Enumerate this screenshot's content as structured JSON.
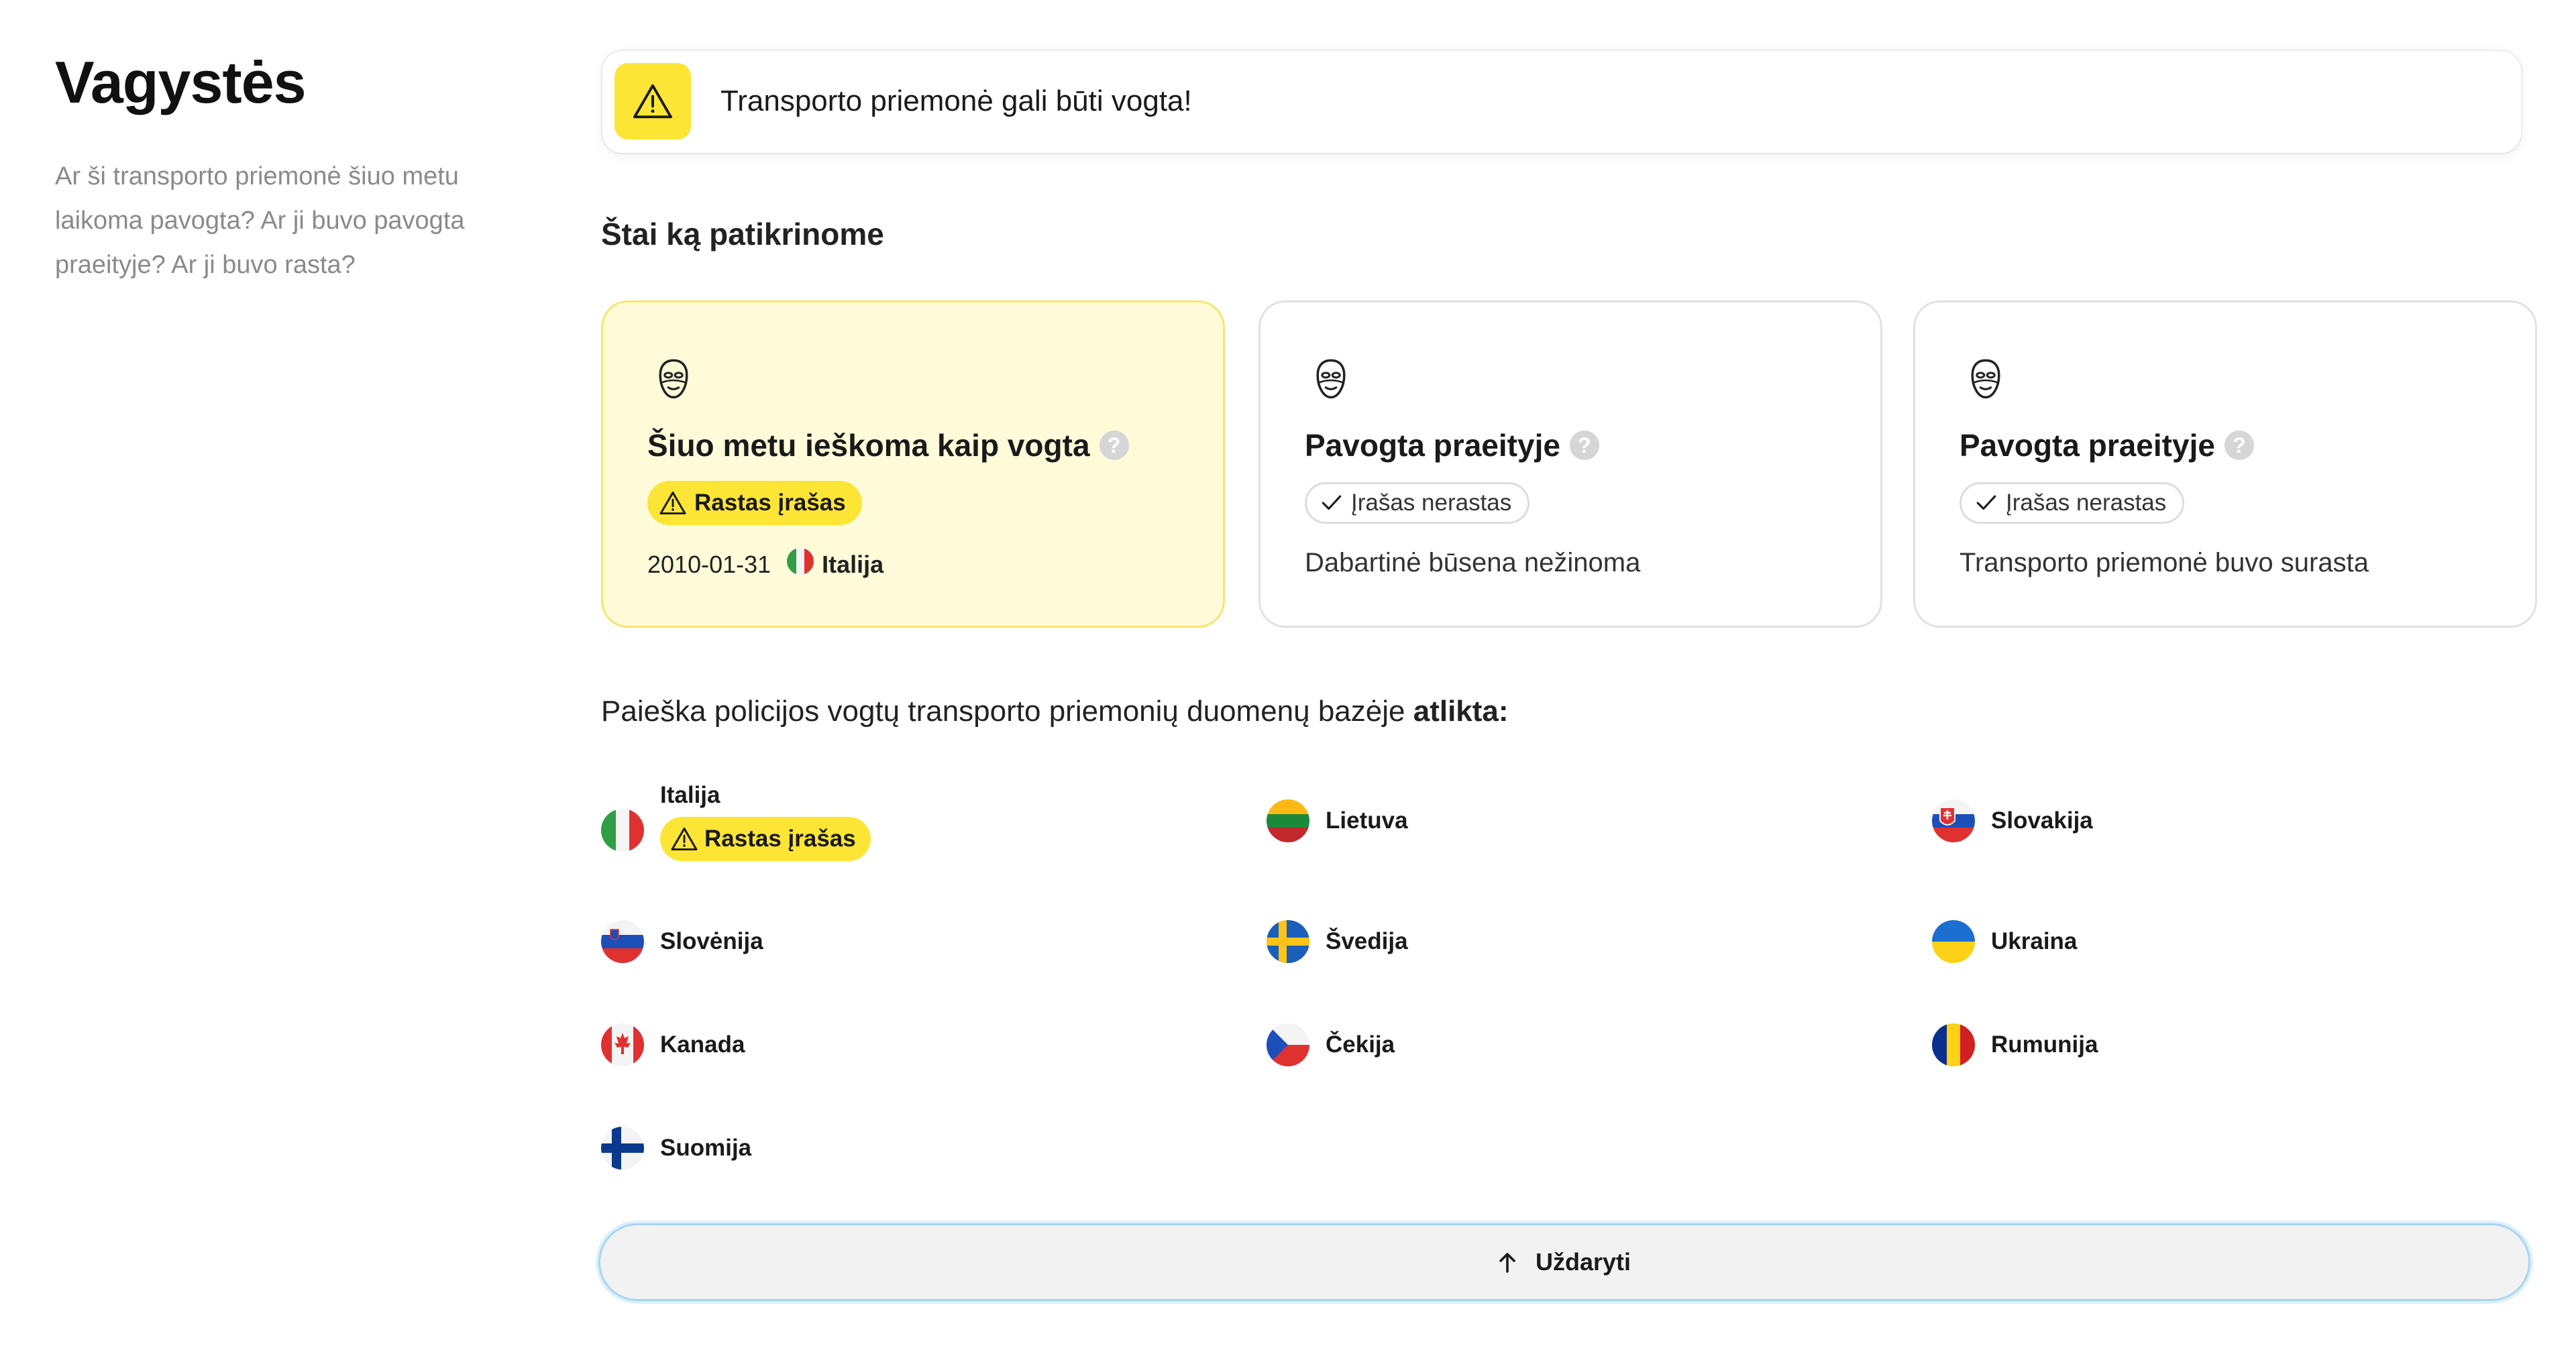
{
  "header": {
    "title": "Vagystės",
    "description": "Ar ši transporto priemonė šiuo metu laikoma pavogta? Ar ji buvo pavogta praeityje? Ar ji buvo rasta?"
  },
  "alert": {
    "icon": "warning-triangle-icon",
    "text": "Transporto priemonė gali būti vogta!"
  },
  "checks": {
    "title": "Štai ką patikrinome",
    "cards": [
      {
        "title": "Šiuo metu ieškoma kaip vogta",
        "help": "?",
        "badge": "Rastas įrašas",
        "date": "2010-01-31",
        "country": "Italija"
      },
      {
        "title": "Pavogta praeityje",
        "help": "?",
        "badge": "Įrašas nerastas",
        "status": "Dabartinė būsena nežinoma"
      },
      {
        "title": "Pavogta praeityje",
        "help": "?",
        "badge": "Įrašas nerastas",
        "status": "Transporto priemonė buvo surasta"
      }
    ]
  },
  "search": {
    "prefix": "Paieška policijos vogtų transporto priemonių duomenų bazėje ",
    "emphasis": "atlikta:"
  },
  "countries": {
    "italy": {
      "name": "Italija",
      "badge": "Rastas įrašas"
    },
    "lithuania": {
      "name": "Lietuva"
    },
    "slovakia": {
      "name": "Slovakija"
    },
    "slovenia": {
      "name": "Slovėnija"
    },
    "sweden": {
      "name": "Švedija"
    },
    "ukraine": {
      "name": "Ukraina"
    },
    "canada": {
      "name": "Kanada"
    },
    "czechia": {
      "name": "Čekija"
    },
    "romania": {
      "name": "Rumunija"
    },
    "finland": {
      "name": "Suomija"
    }
  },
  "close_button": {
    "label": "Uždaryti",
    "icon": "arrow-up-icon"
  },
  "colors": {
    "accent_yellow": "#fde535",
    "highlight_bg": "#fffbd9",
    "button_outline": "#a9d6ef"
  }
}
